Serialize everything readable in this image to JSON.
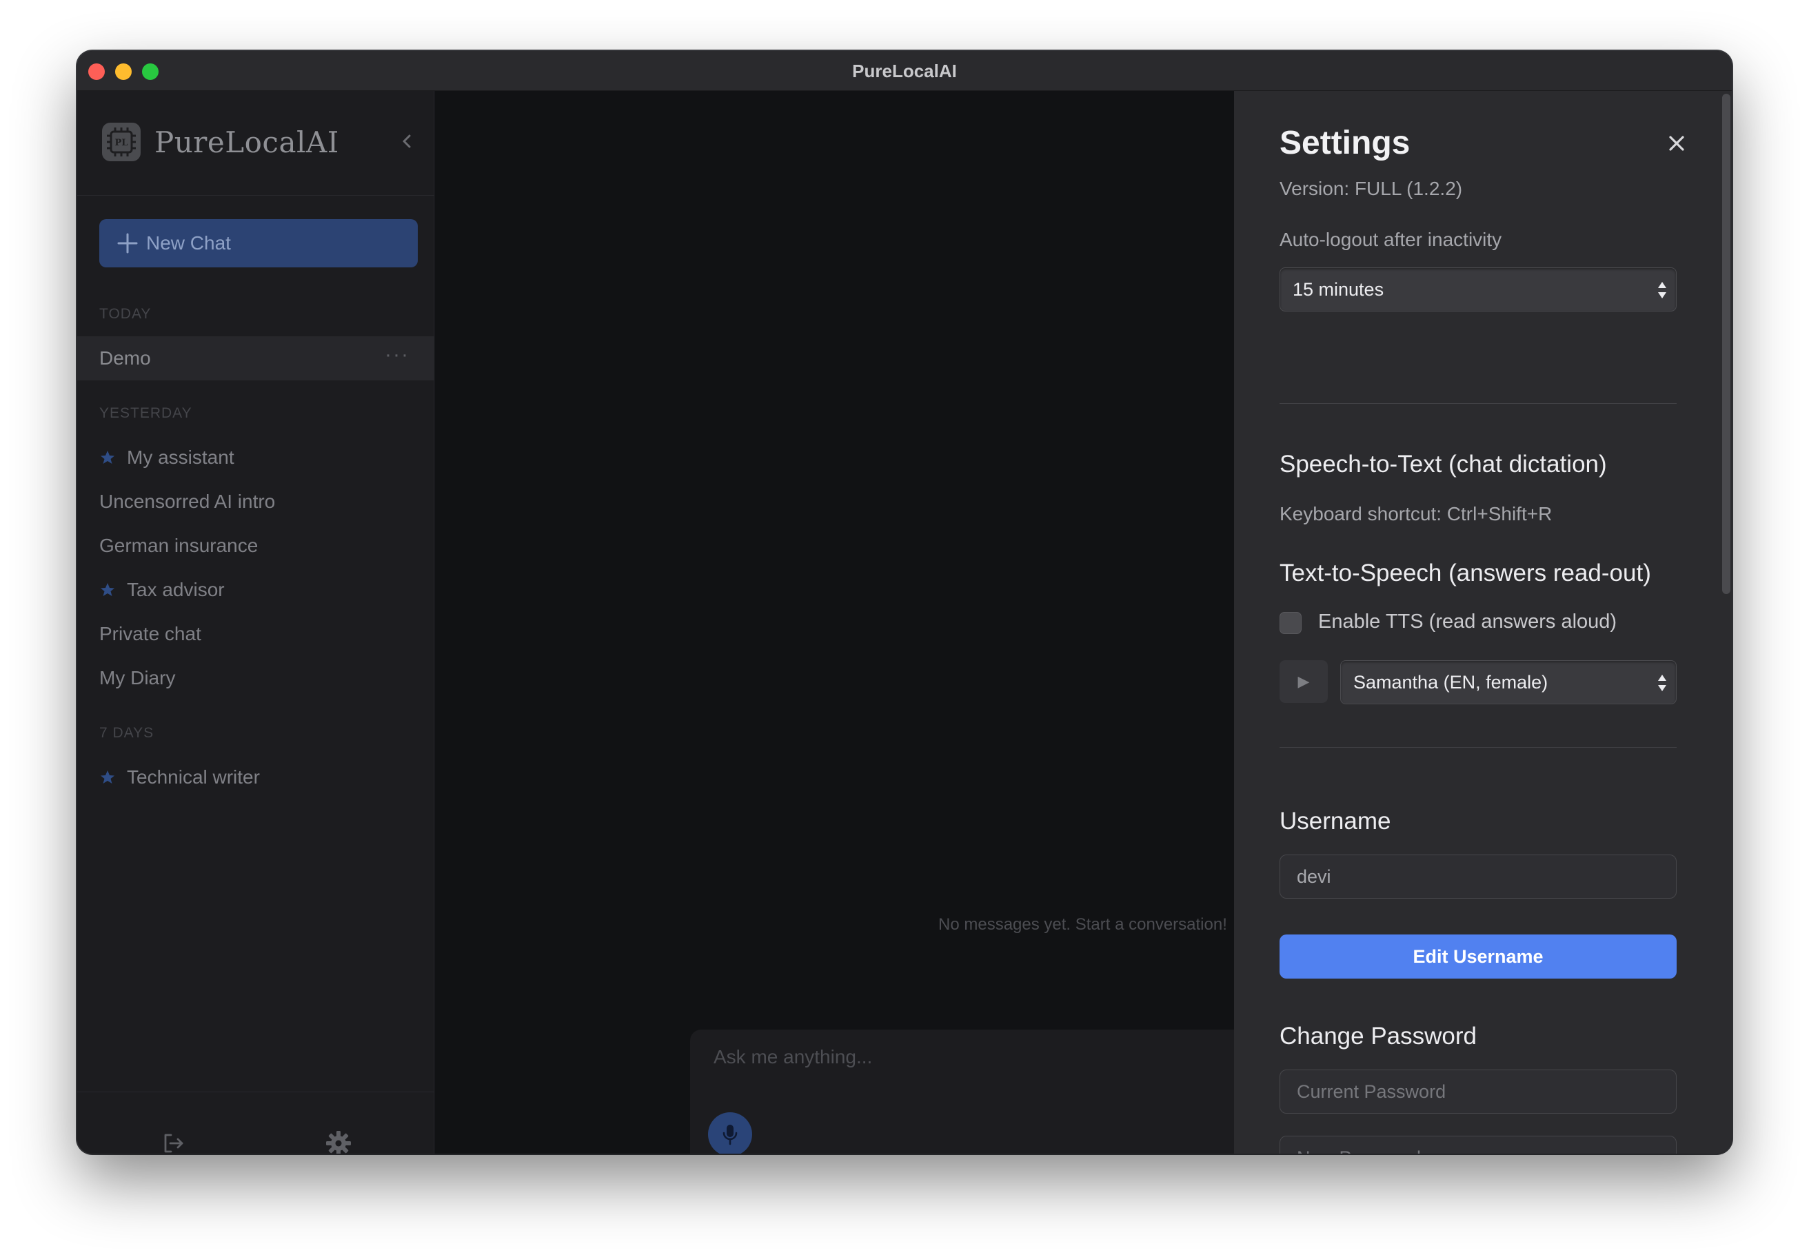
{
  "window": {
    "title": "PureLocalAI"
  },
  "sidebar": {
    "brand": {
      "logo_text": "PL",
      "name": "PureLocalAI"
    },
    "new_chat_label": "New Chat",
    "sections": {
      "today": "TODAY",
      "yesterday": "YESTERDAY",
      "seven_days": "7 DAYS"
    },
    "items": [
      {
        "label": "Demo",
        "starred": false,
        "active": true
      },
      {
        "label": "My assistant",
        "starred": true
      },
      {
        "label": "Uncensorred AI intro",
        "starred": false
      },
      {
        "label": "German insurance",
        "starred": false
      },
      {
        "label": "Tax advisor",
        "starred": true
      },
      {
        "label": "Private chat",
        "starred": false
      },
      {
        "label": "My Diary",
        "starred": false
      },
      {
        "label": "Technical writer",
        "starred": true
      }
    ],
    "more_icon": "ellipsis-icon",
    "footer_icons": [
      "logout-icon",
      "gear-icon"
    ]
  },
  "main": {
    "empty_message": "No messages yet. Start a conversation!",
    "composer_placeholder": "Ask me anything..."
  },
  "settings": {
    "title": "Settings",
    "version": "Version: FULL (1.2.2)",
    "auto_logout_label": "Auto-logout after inactivity",
    "auto_logout_value": "15 minutes",
    "stt_heading": "Speech-to-Text (chat dictation)",
    "stt_shortcut": "Keyboard shortcut: Ctrl+Shift+R",
    "tts_heading": "Text-to-Speech (answers read-out)",
    "tts_enable_label": "Enable TTS (read answers aloud)",
    "tts_enabled": false,
    "play_glyph": "▶",
    "voice_value": "Samantha (EN, female)",
    "username_heading": "Username",
    "username_value": "devi",
    "edit_username_label": "Edit Username",
    "password_heading": "Change Password",
    "current_password_placeholder": "Current Password",
    "new_password_placeholder": "New Password"
  },
  "colors": {
    "accent": "#5181f0",
    "sidebar_button": "#2c4373",
    "star": "#2f4d86"
  }
}
